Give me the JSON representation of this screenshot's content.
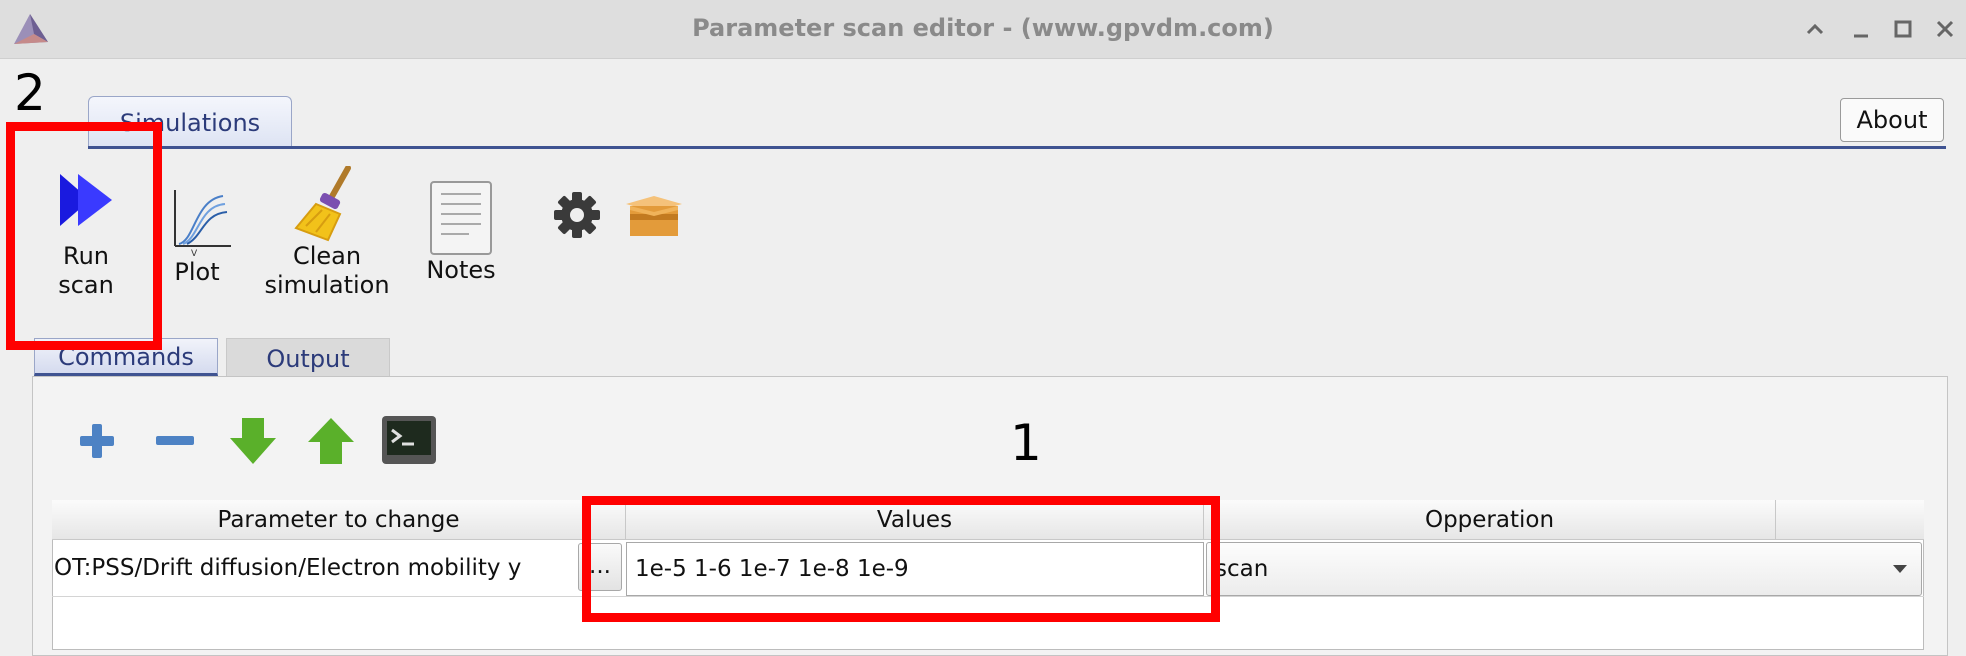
{
  "window": {
    "title": "Parameter scan editor - (www.gpvdm.com)",
    "icons": [
      "app-logo-icon",
      "maximize-chevron-icon",
      "minimize-icon",
      "restore-icon",
      "close-icon"
    ]
  },
  "annotations": {
    "step1": "1",
    "step2": "2",
    "highlight_color": "#ff0000"
  },
  "top_tabs": [
    {
      "label": "Simulations"
    }
  ],
  "about_label": "About",
  "toolbar": {
    "run_scan": "Run\nscan",
    "plot": "Plot",
    "clean": "Clean\nsimulation",
    "notes": "Notes",
    "icons": [
      "run-scan-icon",
      "plot-icon",
      "broom-icon",
      "notes-icon",
      "gear-icon",
      "box-icon"
    ]
  },
  "sub_tabs": [
    {
      "label": "Commands",
      "active": true
    },
    {
      "label": "Output",
      "active": false
    }
  ],
  "command_icons": [
    "add-icon",
    "remove-icon",
    "move-down-icon",
    "move-up-icon",
    "terminal-icon"
  ],
  "table": {
    "headers": [
      "Parameter to change",
      "Values",
      "Opperation"
    ],
    "rows": [
      {
        "parameter": "OT:PSS/Drift diffusion/Electron mobility y",
        "browse": "...",
        "values": "1e-5 1-6 1e-7 1e-8 1e-9",
        "operation": "scan"
      }
    ]
  },
  "colors": {
    "accent": "#3f5391",
    "run_arrow": "#2020e0",
    "add_minus": "#4d82c4",
    "arrows_green": "#5ab02a"
  }
}
